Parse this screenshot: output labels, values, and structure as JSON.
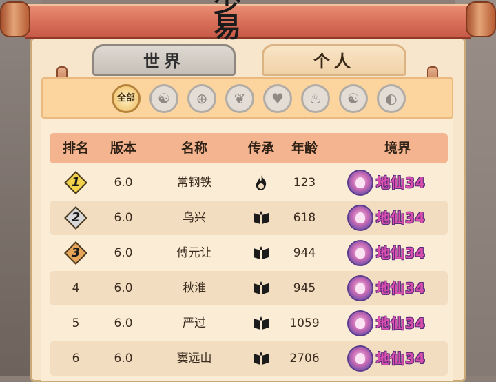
{
  "banner": {
    "title": "少 易"
  },
  "tabs": {
    "world": "世界",
    "personal": "个人",
    "active": "personal"
  },
  "filters": {
    "all_label": "全部",
    "icons": [
      "taiji-icon",
      "compass-icon",
      "book-icon",
      "heart-icon",
      "flame-icon",
      "yin-yang-icon",
      "partial-icon"
    ]
  },
  "table": {
    "headers": {
      "rank": "排名",
      "version": "版本",
      "name": "名称",
      "inheritance": "传承",
      "age": "年龄",
      "realm": "境界"
    },
    "rows": [
      {
        "rank": "1",
        "version": "6.0",
        "name": "常钢铁",
        "inheritance": "flame-icon",
        "age": "123",
        "realm": "地仙34"
      },
      {
        "rank": "2",
        "version": "6.0",
        "name": "乌兴",
        "inheritance": "book-icon",
        "age": "618",
        "realm": "地仙34"
      },
      {
        "rank": "3",
        "version": "6.0",
        "name": "傅元让",
        "inheritance": "book-icon",
        "age": "944",
        "realm": "地仙34"
      },
      {
        "rank": "4",
        "version": "6.0",
        "name": "秋淮",
        "inheritance": "book-icon",
        "age": "945",
        "realm": "地仙34"
      },
      {
        "rank": "5",
        "version": "6.0",
        "name": "严过",
        "inheritance": "book-icon",
        "age": "1059",
        "realm": "地仙34"
      },
      {
        "rank": "6",
        "version": "6.0",
        "name": "窦远山",
        "inheritance": "book-icon",
        "age": "2706",
        "realm": "地仙34"
      }
    ]
  },
  "colors": {
    "gold": "#f1d24a",
    "silver": "#d9d9d9",
    "bronze": "#e7a55a",
    "realm_text": "#d94fae"
  }
}
